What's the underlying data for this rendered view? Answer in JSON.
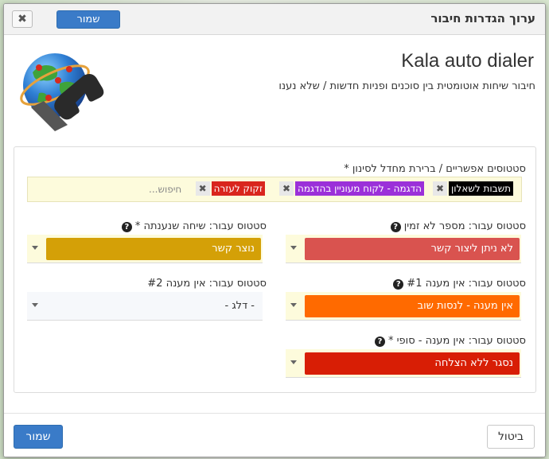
{
  "header": {
    "title": "ערוך הגדרות חיבור",
    "close_glyph": "✖",
    "save_label": "שמור"
  },
  "app": {
    "title": "Kala auto dialer",
    "subtitle": "חיבור שיחות אוטומטית בין סוכנים ופניות חדשות / שלא נענו",
    "logo_icon": "globe-phone-icon"
  },
  "filter": {
    "label": "סטטוסים אפשריים / ברירת מחדל לסינון *",
    "tags": [
      {
        "label": "תשבות לשאלון",
        "color": "#000000"
      },
      {
        "label": "הדגמה - לקוח מעוניין בהדגמה",
        "color": "#9b30d9"
      },
      {
        "label": "זקוק לעזרה",
        "color": "#d9251d"
      }
    ],
    "remove_glyph": "✖",
    "search_placeholder": "חיפוש..."
  },
  "fields": {
    "no_time": {
      "label": "סטטוס עבור: מספר לא זמין",
      "value": "לא ניתן ליצור קשר",
      "color": "#d9534f"
    },
    "callback": {
      "label": "סטטוס עבור: שיחה שנענתה *",
      "value": "נוצר קשר",
      "color": "#d4a007"
    },
    "no_answer_1": {
      "label": "סטטוס עבור: אין מענה #1",
      "value": "אין מענה - לנסות שוב",
      "color": "#ff6a00"
    },
    "no_answer_2": {
      "label": "סטטוס עבור: אין מענה #2",
      "value": "- דלג -"
    },
    "no_answer_final": {
      "label": "סטטוס עבור: אין מענה - סופי *",
      "value": "נסגר ללא הצלחה",
      "color": "#d81e05"
    }
  },
  "help_glyph": "?",
  "footer": {
    "save_label": "שמור",
    "cancel_label": "ביטול"
  }
}
